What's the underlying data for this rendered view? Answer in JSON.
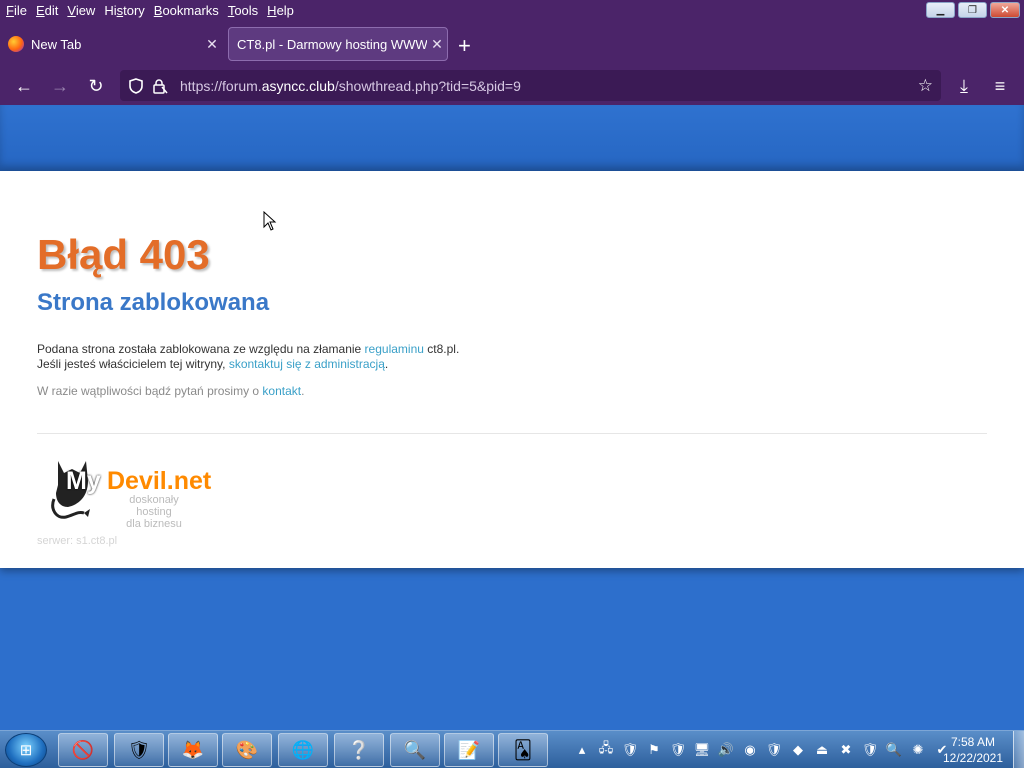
{
  "menubar": {
    "items": [
      {
        "label": "File",
        "key": "F",
        "rest": "ile"
      },
      {
        "label": "Edit",
        "key": "E",
        "rest": "dit"
      },
      {
        "label": "View",
        "key": "V",
        "rest": "iew"
      },
      {
        "label": "History",
        "key": "s",
        "pre": "Hi",
        "rest": "tory"
      },
      {
        "label": "Bookmarks",
        "key": "B",
        "rest": "ookmarks"
      },
      {
        "label": "Tools",
        "key": "T",
        "rest": "ools"
      },
      {
        "label": "Help",
        "key": "H",
        "rest": "elp"
      }
    ]
  },
  "tabs": [
    {
      "title": "New Tab"
    },
    {
      "title": "CT8.pl - Darmowy hosting WWW - "
    }
  ],
  "url": {
    "scheme": "https://forum.",
    "host": "asyncc.club",
    "path": "/showthread.php?tid=5&pid=9"
  },
  "page": {
    "title": "Błąd 403",
    "subtitle": "Strona zablokowana",
    "line1_pre": "Podana strona została zablokowana ze względu na złamanie ",
    "line1_link": "regulaminu",
    "line1_post": " ct8.pl.",
    "line2_pre": "Jeśli jesteś właścicielem tej witryny, ",
    "line2_link": "skontaktuj się z administracją",
    "line2_post": ".",
    "line3_pre": "W razie wątpliwości bądź pytań prosimy o ",
    "line3_link": "kontakt",
    "line3_post": ".",
    "logo_my": "My",
    "logo_devil": "Devil.net",
    "logo_sub1": "doskonały hosting",
    "logo_sub2": "dla biznesu",
    "server": "serwer: s1.ct8.pl"
  },
  "taskbar": {
    "time": "7:58 AM",
    "date": "12/22/2021"
  }
}
